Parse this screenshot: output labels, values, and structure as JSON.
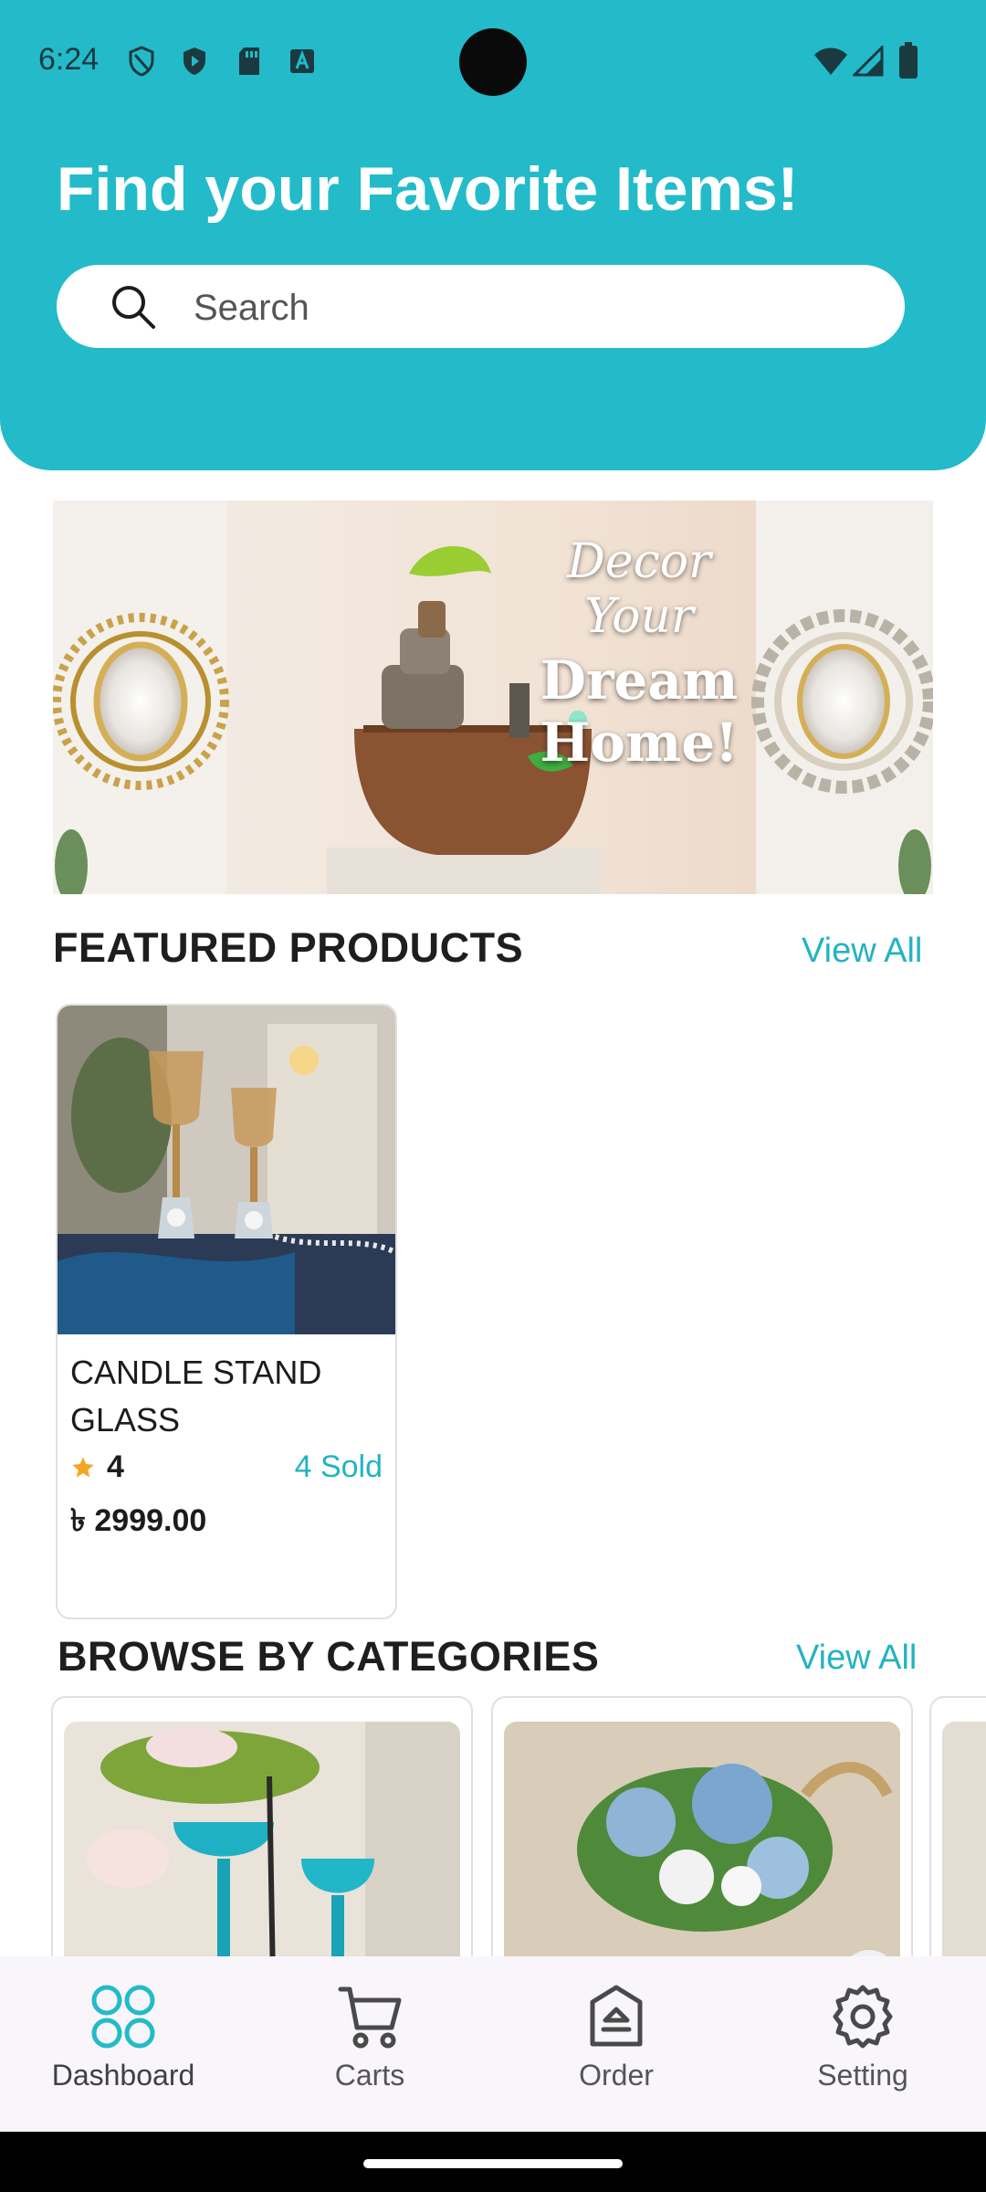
{
  "status_bar": {
    "time": "6:24"
  },
  "header": {
    "title": "Find your Favorite Items!",
    "search_placeholder": "Search",
    "background_color": "#23bbc9"
  },
  "banner": {
    "line1": "Decor Your",
    "line2": "Dream Home!"
  },
  "featured": {
    "title": "FEATURED PRODUCTS",
    "view_all": "View All",
    "products": [
      {
        "name": "CANDLE STAND GLASS",
        "rating": "4",
        "sold": "4 Sold",
        "price": "৳ 2999.00"
      }
    ]
  },
  "categories": {
    "title": "BROWSE BY CATEGORIES",
    "view_all": "View All"
  },
  "bottom_nav": {
    "items": [
      {
        "label": "Dashboard",
        "icon": "grid-circles-icon"
      },
      {
        "label": "Carts",
        "icon": "cart-icon"
      },
      {
        "label": "Order",
        "icon": "order-icon"
      },
      {
        "label": "Setting",
        "icon": "gear-icon"
      }
    ],
    "active": "Dashboard",
    "accent_color": "#23bbc9"
  }
}
